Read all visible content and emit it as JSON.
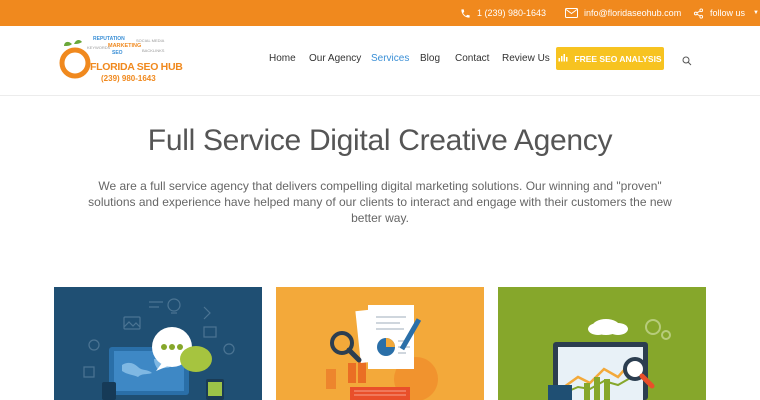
{
  "topbar": {
    "phone": "1 (239) 980-1643",
    "email": "info@floridaseohub.com",
    "follow": "follow us"
  },
  "logo": {
    "brand": "FLORIDA SEO HUB",
    "phone": "(239) 980-1643",
    "cloud_words": [
      "REPUTATION",
      "MARKETING",
      "SEO",
      "SOCIAL MEDIA",
      "KEYWORDS",
      "BACKLINKS"
    ]
  },
  "nav": {
    "items": [
      "Home",
      "Our Agency",
      "Services",
      "Blog",
      "Contact",
      "Review Us"
    ],
    "active": "Services",
    "cta": "FREE SEO ANALYSIS"
  },
  "hero": {
    "title": "Full Service Digital Creative Agency",
    "text": "We are a full service agency that delivers compelling digital marketing solutions. Our winning and \"proven\" solutions and experience have helped many of our clients to interact and engage with their customers the new better way."
  },
  "colors": {
    "accent": "#f0891e",
    "cta": "#f7c320",
    "active_link": "#3a8fd6",
    "card_blue": "#1f4f73",
    "card_orange": "#f3a93a",
    "card_green": "#86a72b"
  },
  "icons": [
    "phone-icon",
    "mail-icon",
    "share-icon",
    "chart-icon",
    "search-icon"
  ]
}
